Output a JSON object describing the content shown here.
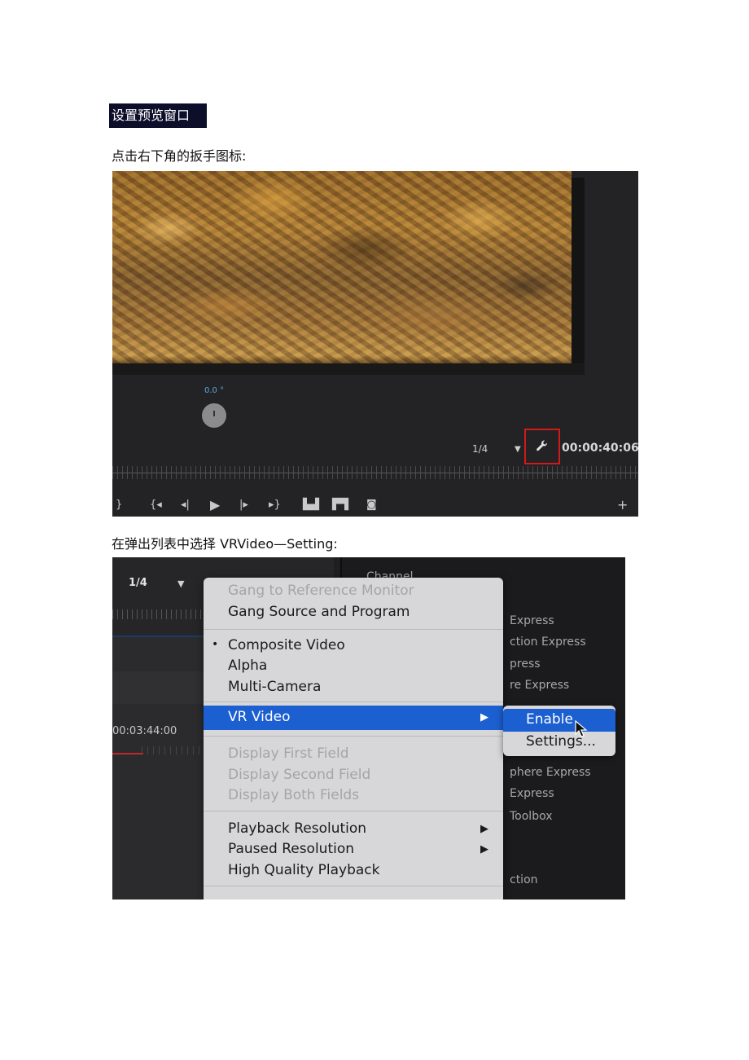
{
  "heading": "设置预览窗口",
  "paragraphs": {
    "p1": "点击右下角的扳手图标:",
    "p2": "在弹出列表中选择 VRVideo—Setting:"
  },
  "shot1": {
    "angle_label": "0.0 °",
    "scale": "1/4",
    "timecode": "00:00:40:06",
    "icons": {
      "wrench": "wrench-icon",
      "dropdown": "triangle-down-icon",
      "controls": [
        "mark-in-icon",
        "go-to-in-icon",
        "step-back-icon",
        "play-icon",
        "step-forward-icon",
        "go-to-out-icon",
        "insert-icon",
        "overwrite-icon",
        "camera-icon",
        "add-icon"
      ]
    },
    "colors": {
      "highlight_box": "#d21a1a",
      "angle_label": "#5aa3d8"
    }
  },
  "shot2": {
    "scale": "1/4",
    "timecode": "00:03:44:00",
    "right_panel_items": [
      "Channel",
      "Express",
      "ction Express",
      "press",
      "re Express",
      "phere Express",
      "Express",
      "Toolbox",
      "ction"
    ],
    "menu": {
      "gang_to_reference": "Gang to Reference Monitor",
      "gang_source_program": "Gang Source and Program",
      "composite_video": "Composite Video",
      "alpha": "Alpha",
      "multi_camera": "Multi-Camera",
      "vr_video": "VR Video",
      "display_first": "Display First Field",
      "display_second": "Display Second Field",
      "display_both": "Display Both Fields",
      "playback_resolution": "Playback Resolution",
      "paused_resolution": "Paused Resolution",
      "high_quality": "High Quality Playback"
    },
    "submenu": {
      "enable": "Enable",
      "settings": "Settings..."
    },
    "colors": {
      "menu_highlight": "#1b5fd0"
    }
  }
}
